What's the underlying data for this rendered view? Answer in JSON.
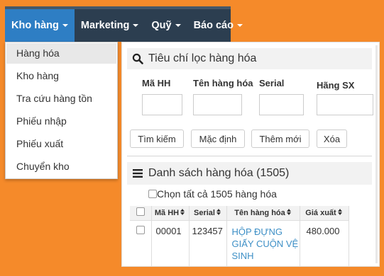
{
  "nav": {
    "items": [
      {
        "label": "Kho hàng"
      },
      {
        "label": "Marketing"
      },
      {
        "label": "Quỹ"
      },
      {
        "label": "Báo cáo"
      }
    ]
  },
  "dropdown": {
    "items": [
      {
        "label": "Hàng hóa"
      },
      {
        "label": "Kho hàng"
      },
      {
        "label": "Tra cứu hàng tồn"
      },
      {
        "label": "Phiếu nhập"
      },
      {
        "label": "Phiếu xuất"
      },
      {
        "label": "Chuyển kho"
      }
    ]
  },
  "filter": {
    "title": "Tiêu chí lọc hàng hóa",
    "fields": [
      {
        "label": "Mã HH",
        "value": ""
      },
      {
        "label": "Tên hàng hóa",
        "value": ""
      },
      {
        "label": "Serial",
        "value": ""
      },
      {
        "label": "Hãng SX",
        "value": ""
      }
    ],
    "buttons": {
      "search": "Tìm kiếm",
      "default": "Mặc định",
      "add": "Thêm mới",
      "delete": "Xóa"
    }
  },
  "list": {
    "title": "Danh sách hàng hóa (1505)",
    "select_all": "Chọn tất cả 1505 hàng hóa",
    "columns": [
      "Mã HH",
      "Serial",
      "Tên hàng hóa",
      "Giá xuất"
    ],
    "rows": [
      {
        "code": "00001",
        "serial": "123457",
        "name": "HỘP ĐỰNG GIẤY CUỘN VỆ SINH",
        "price": "480.000"
      }
    ]
  },
  "colors": {
    "background": "#f58a2a",
    "navbar": "#2c3e50",
    "nav_active": "#2e7ec4",
    "link": "#3d8fc6"
  }
}
